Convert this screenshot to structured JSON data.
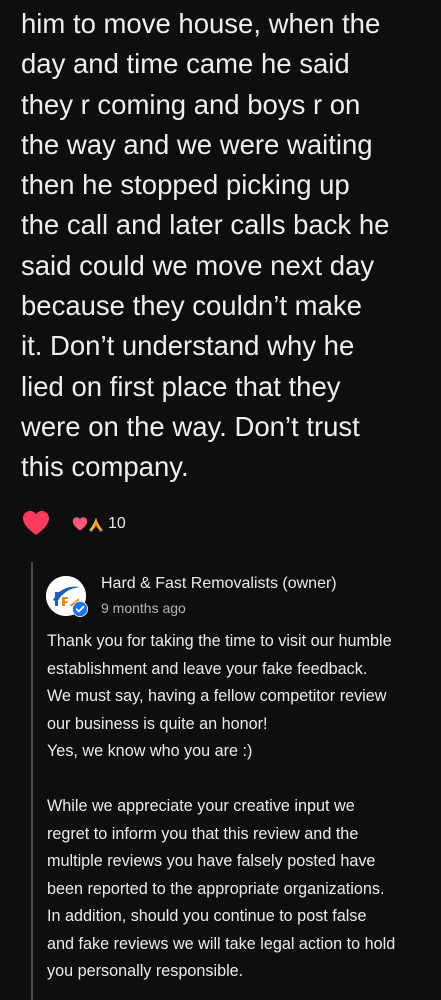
{
  "review": {
    "lines": [
      "him to move house, when the",
      "day and time came he said",
      "they r coming and boys r on",
      "the way and we were waiting",
      "then he stopped picking up",
      "the call and later calls back he",
      "said could we move next day",
      "because they couldn’t make",
      "it. Don’t understand why he",
      "lied on first place that they",
      "were on the way. Don’t trust",
      "this company."
    ]
  },
  "reactions": {
    "primary_icon": "heart-icon",
    "summary_icons": [
      "heart-icon",
      "praying-hands-icon"
    ],
    "count": "10",
    "heart_color": "#ff3b5c"
  },
  "owner_reply": {
    "name": "Hard & Fast Removalists (owner)",
    "date": "9 months ago",
    "avatar_icon": "business-logo-avatar",
    "verified_icon": "verified-badge-icon",
    "verified_color": "#1a73e8",
    "paragraph1": [
      "Thank you for taking the time to visit our humble",
      "establishment and leave your fake feedback.",
      "We must say, having a fellow competitor review",
      "our business is quite an honor!",
      "Yes, we know who you are :)"
    ],
    "paragraph2": [
      "While we appreciate your creative input we",
      "regret to inform you that this review and the",
      "multiple reviews you have falsely posted have",
      "been reported to the appropriate organizations.",
      "In addition, should you continue to post false",
      "and fake reviews we will take legal action to hold",
      "you personally responsible."
    ]
  }
}
